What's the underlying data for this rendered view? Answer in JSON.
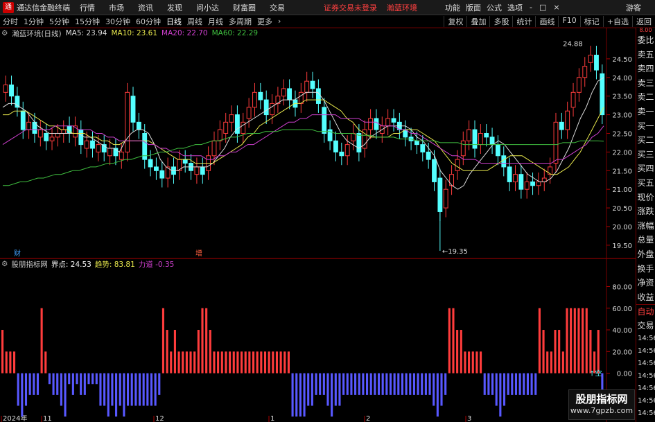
{
  "menu": {
    "app_title": "通达信金融终端",
    "items": [
      "行情",
      "市场",
      "资讯",
      "发现",
      "问小达",
      "财富圈",
      "交易"
    ],
    "notice": "证券交易未登录",
    "stock_name": "瀚蓝环境",
    "right_items": [
      "功能",
      "版面",
      "公式",
      "选项"
    ],
    "guest": "游客",
    "window_controls": [
      "-",
      "□",
      "×"
    ]
  },
  "periods": {
    "items": [
      "分时",
      "1分钟",
      "5分钟",
      "15分钟",
      "30分钟",
      "60分钟",
      "日线",
      "周线",
      "月线",
      "多周期",
      "更多"
    ],
    "active": "日线",
    "right_buttons": [
      "复权",
      "叠加",
      "多股",
      "统计",
      "画线",
      "F10",
      "标记",
      "+自选",
      "返回"
    ]
  },
  "main_legend": {
    "title": "瀚蓝环境(日线)",
    "ma": [
      {
        "label": "MA5: 23.94",
        "color": "#dddddd"
      },
      {
        "label": "MA10: 23.61",
        "color": "#e8e84c"
      },
      {
        "label": "MA20: 22.70",
        "color": "#d040d0"
      },
      {
        "label": "MA60: 22.29",
        "color": "#40c040"
      }
    ]
  },
  "price_axis": [
    "24.50",
    "24.00",
    "23.50",
    "23.00",
    "22.50",
    "22.00",
    "21.50",
    "21.00",
    "20.50",
    "20.00",
    "19.50"
  ],
  "price_annotations": {
    "high": "24.88",
    "low": "19.35"
  },
  "event_markers": [
    {
      "label": "财",
      "color": "#40a0ff"
    },
    {
      "label": "增",
      "color": "#ff6040"
    }
  ],
  "indicator_legend": {
    "name": "股朋指标网",
    "items": [
      {
        "label": "界点: 24.53",
        "color": "#ffffff"
      },
      {
        "label": "趋势: 83.81",
        "color": "#e8e84c"
      },
      {
        "label": "力道 -0.35",
        "color": "#d040d0"
      }
    ]
  },
  "indicator_axis": [
    "80.00",
    "60.00",
    "40.00",
    "20.00",
    "0.00",
    "-20.00",
    "-40.00"
  ],
  "indicator_tag": "空",
  "date_axis": [
    "2024年",
    "11",
    "12",
    "1",
    "2",
    "3"
  ],
  "right_panel": {
    "labels": [
      "委比",
      "卖五",
      "卖四",
      "卖三",
      "卖二",
      "卖一",
      "买一",
      "买二",
      "买三",
      "买四",
      "买五",
      "现价",
      "涨跌",
      "涨幅",
      "总量",
      "外盘",
      "换手",
      "净资",
      "收益"
    ],
    "tabs": [
      "自动",
      "交易"
    ],
    "times": [
      "14:56",
      "14:56",
      "14:56",
      "14:56",
      "14:56",
      "14:56",
      "14:56",
      "14:56"
    ],
    "top_marker": "8.00"
  },
  "watermark": {
    "title": "股朋指标网",
    "url": "www.7gpzb.com"
  },
  "chart_data": {
    "type": "candlestick",
    "y_range": [
      19.2,
      25.0
    ],
    "closes": [
      23.8,
      23.5,
      23.2,
      22.6,
      22.8,
      22.5,
      22.6,
      22.3,
      22.4,
      22.5,
      22.6,
      22.5,
      22.7,
      22.2,
      22.3,
      22.1,
      22.2,
      22.0,
      22.1,
      21.9,
      22.0,
      23.6,
      22.8,
      22.6,
      21.8,
      21.6,
      21.5,
      21.3,
      21.6,
      21.4,
      21.8,
      21.7,
      21.5,
      21.6,
      21.4,
      21.9,
      22.3,
      22.6,
      22.8,
      23.0,
      22.5,
      22.8,
      23.2,
      23.6,
      23.4,
      23.0,
      23.3,
      23.5,
      23.7,
      23.4,
      23.2,
      23.6,
      23.9,
      23.7,
      23.3,
      22.5,
      22.3,
      22.0,
      21.9,
      22.2,
      22.5,
      22.0,
      22.6,
      22.9,
      22.6,
      22.7,
      22.9,
      22.8,
      22.6,
      22.4,
      22.3,
      22.2,
      22.0,
      21.8,
      21.2,
      20.4,
      21.0,
      21.4,
      21.8,
      22.3,
      22.6,
      22.1,
      22.5,
      22.4,
      22.2,
      21.9,
      21.6,
      21.2,
      21.4,
      21.0,
      21.2,
      21.1,
      21.2,
      21.3,
      21.6,
      22.8,
      22.6,
      23.1,
      23.6,
      24.0,
      24.3,
      24.6,
      24.2,
      23.0
    ],
    "opens": [
      23.6,
      23.8,
      23.5,
      23.1,
      22.6,
      22.8,
      22.4,
      22.5,
      22.3,
      22.4,
      22.5,
      22.7,
      22.4,
      22.6,
      22.1,
      22.3,
      22.0,
      22.2,
      21.9,
      22.1,
      21.8,
      22.0,
      23.5,
      22.8,
      22.5,
      21.8,
      21.6,
      21.5,
      21.3,
      21.6,
      21.5,
      21.8,
      21.7,
      21.4,
      21.6,
      21.5,
      21.9,
      22.3,
      22.5,
      22.8,
      23.0,
      22.5,
      22.9,
      23.2,
      23.6,
      23.4,
      23.0,
      23.3,
      23.5,
      23.7,
      23.4,
      23.3,
      23.6,
      23.9,
      23.7,
      23.2,
      22.6,
      22.3,
      22.0,
      21.9,
      22.3,
      22.5,
      22.1,
      22.6,
      22.9,
      22.5,
      22.7,
      22.9,
      22.8,
      22.6,
      22.4,
      22.3,
      22.2,
      22.0,
      21.8,
      21.3,
      20.5,
      21.1,
      21.5,
      21.9,
      22.3,
      22.6,
      22.2,
      22.5,
      22.4,
      22.2,
      21.9,
      21.6,
      21.2,
      21.4,
      21.0,
      21.2,
      21.1,
      21.2,
      21.4,
      21.7,
      22.8,
      22.6,
      23.2,
      23.6,
      24.0,
      24.4,
      24.6,
      24.1
    ],
    "ma5": [
      23.2,
      23.3,
      23.3,
      23.2,
      23.1,
      22.9,
      22.7,
      22.6,
      22.5,
      22.5,
      22.5,
      22.5,
      22.5,
      22.5,
      22.4,
      22.4,
      22.3,
      22.2,
      22.1,
      22.1,
      22.0,
      22.3,
      22.5,
      22.6,
      22.6,
      22.5,
      22.2,
      21.8,
      21.6,
      21.5,
      21.5,
      21.6,
      21.6,
      21.6,
      21.6,
      21.6,
      21.7,
      21.9,
      22.1,
      22.4,
      22.6,
      22.7,
      22.8,
      22.9,
      23.0,
      23.1,
      23.2,
      23.3,
      23.4,
      23.4,
      23.4,
      23.5,
      23.6,
      23.6,
      23.6,
      23.4,
      23.1,
      22.8,
      22.5,
      22.3,
      22.2,
      22.1,
      22.2,
      22.4,
      22.5,
      22.6,
      22.7,
      22.7,
      22.7,
      22.7,
      22.6,
      22.4,
      22.3,
      22.1,
      21.9,
      21.5,
      21.3,
      21.1,
      21.0,
      21.1,
      21.4,
      21.6,
      21.8,
      22.0,
      22.2,
      22.3,
      22.2,
      22.0,
      21.8,
      21.6,
      21.4,
      21.3,
      21.2,
      21.2,
      21.3,
      21.5,
      21.8,
      22.1,
      22.5,
      22.9,
      23.2,
      23.6,
      23.9,
      24.0
    ],
    "ma10": [
      23.0,
      23.0,
      23.1,
      23.1,
      23.1,
      23.0,
      22.9,
      22.8,
      22.7,
      22.7,
      22.6,
      22.6,
      22.5,
      22.5,
      22.5,
      22.4,
      22.4,
      22.3,
      22.3,
      22.2,
      22.2,
      22.3,
      22.3,
      22.3,
      22.3,
      22.3,
      22.2,
      22.1,
      22.0,
      21.9,
      21.8,
      21.8,
      21.8,
      21.7,
      21.7,
      21.7,
      21.7,
      21.8,
      21.9,
      22.0,
      22.1,
      22.2,
      22.4,
      22.5,
      22.7,
      22.8,
      22.9,
      23.0,
      23.1,
      23.2,
      23.3,
      23.3,
      23.4,
      23.4,
      23.4,
      23.4,
      23.3,
      23.2,
      23.1,
      22.9,
      22.8,
      22.6,
      22.5,
      22.4,
      22.4,
      22.4,
      22.4,
      22.5,
      22.5,
      22.6,
      22.6,
      22.6,
      22.5,
      22.4,
      22.3,
      22.1,
      21.9,
      21.7,
      21.6,
      21.5,
      21.5,
      21.5,
      21.5,
      21.5,
      21.6,
      21.7,
      21.8,
      21.9,
      21.9,
      21.9,
      21.8,
      21.7,
      21.6,
      21.5,
      21.4,
      21.4,
      21.5,
      21.6,
      21.8,
      22.0,
      22.3,
      22.6,
      22.9,
      23.2
    ],
    "ma20": [
      22.2,
      22.3,
      22.4,
      22.5,
      22.6,
      22.6,
      22.6,
      22.6,
      22.6,
      22.7,
      22.7,
      22.7,
      22.7,
      22.6,
      22.6,
      22.6,
      22.5,
      22.5,
      22.4,
      22.4,
      22.3,
      22.3,
      22.3,
      22.3,
      22.3,
      22.2,
      22.2,
      22.1,
      22.1,
      22.0,
      22.0,
      21.9,
      21.9,
      21.9,
      21.9,
      21.8,
      21.8,
      21.9,
      21.9,
      22.0,
      22.0,
      22.1,
      22.2,
      22.2,
      22.3,
      22.4,
      22.5,
      22.6,
      22.7,
      22.8,
      22.8,
      22.9,
      22.9,
      23.0,
      23.0,
      23.0,
      23.0,
      23.0,
      22.9,
      22.9,
      22.9,
      22.9,
      22.8,
      22.8,
      22.8,
      22.7,
      22.7,
      22.7,
      22.6,
      22.6,
      22.5,
      22.5,
      22.4,
      22.3,
      22.2,
      22.1,
      22.0,
      21.9,
      21.9,
      21.8,
      21.8,
      21.8,
      21.7,
      21.7,
      21.7,
      21.7,
      21.7,
      21.7,
      21.7,
      21.7,
      21.7,
      21.7,
      21.7,
      21.7,
      21.7,
      21.8,
      21.8,
      21.9,
      22.0,
      22.1,
      22.2,
      22.4,
      22.5,
      22.7
    ],
    "ma60": [
      21.1,
      21.1,
      21.15,
      21.2,
      21.2,
      21.25,
      21.3,
      21.3,
      21.35,
      21.4,
      21.4,
      21.45,
      21.5,
      21.5,
      21.55,
      21.6,
      21.6,
      21.65,
      21.7,
      21.7,
      21.75,
      21.8,
      21.8,
      21.85,
      21.9,
      21.9,
      21.95,
      22.0,
      22.0,
      22.05,
      22.1,
      22.1,
      22.15,
      22.2,
      22.2,
      22.25,
      22.3,
      22.3,
      22.35,
      22.4,
      22.4,
      22.45,
      22.5,
      22.5,
      22.5,
      22.55,
      22.55,
      22.55,
      22.6,
      22.6,
      22.6,
      22.6,
      22.6,
      22.6,
      22.55,
      22.55,
      22.55,
      22.5,
      22.5,
      22.5,
      22.5,
      22.45,
      22.45,
      22.45,
      22.4,
      22.4,
      22.4,
      22.4,
      22.35,
      22.35,
      22.35,
      22.3,
      22.3,
      22.3,
      22.3,
      22.25,
      22.25,
      22.25,
      22.25,
      22.2,
      22.2,
      22.2,
      22.2,
      22.2,
      22.2,
      22.2,
      22.2,
      22.2,
      22.2,
      22.2,
      22.2,
      22.2,
      22.2,
      22.2,
      22.2,
      22.2,
      22.25,
      22.25,
      22.25,
      22.3,
      22.3,
      22.3,
      22.3,
      22.29
    ],
    "indicator": [
      40,
      20,
      20,
      20,
      -30,
      -40,
      -30,
      -20,
      -20,
      -20,
      60,
      20,
      -10,
      -20,
      -20,
      -30,
      -40,
      -10,
      -20,
      -10,
      -20,
      -20,
      -10,
      -10,
      -10,
      -30,
      -30,
      -40,
      -30,
      -40,
      -30,
      -40,
      -30,
      -30,
      -30,
      -30,
      -30,
      -30,
      -30,
      -30,
      -20,
      60,
      40,
      20,
      40,
      20,
      20,
      20,
      20,
      20,
      40,
      60,
      60,
      40,
      20,
      20,
      20,
      20,
      20,
      20,
      20,
      20,
      20,
      20,
      20,
      20,
      20,
      20,
      20,
      20,
      20,
      20,
      20,
      20,
      -40,
      -40,
      -40,
      -40,
      -30,
      -30,
      -20,
      -20,
      -20,
      -30,
      -40,
      -30,
      -30,
      -20,
      -20,
      -20,
      -20,
      -20,
      -20,
      -20,
      -20,
      -20,
      -20,
      -20,
      -20,
      -20,
      -20,
      -20,
      -20,
      -20,
      -20,
      -20,
      -20,
      -20,
      -20,
      -20,
      -30,
      -40,
      -30,
      -20,
      60,
      60,
      40,
      40,
      20,
      20,
      20,
      20,
      20,
      -20,
      -20,
      -20,
      -30,
      -40,
      -30,
      -20,
      -20,
      -20,
      -20,
      -20,
      -20,
      -20,
      -20,
      60,
      40,
      20,
      20,
      40,
      40,
      20,
      60,
      60,
      60,
      60,
      60,
      60,
      40,
      20,
      40,
      -40
    ]
  }
}
